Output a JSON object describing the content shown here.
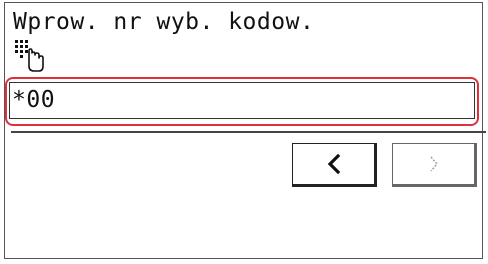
{
  "screen": {
    "prompt": "Wprow. nr wyb. kodow.",
    "entry_value": "*00"
  },
  "icons": {
    "keypad": "keypad-hand-icon",
    "prev": "chevron-left-icon",
    "next": "chevron-right-icon"
  },
  "colors": {
    "highlight": "#e0303a",
    "text": "#111111",
    "border": "#222222",
    "disabled": "#9a9a9a"
  },
  "buttons": {
    "prev_enabled": true,
    "next_enabled": false
  }
}
